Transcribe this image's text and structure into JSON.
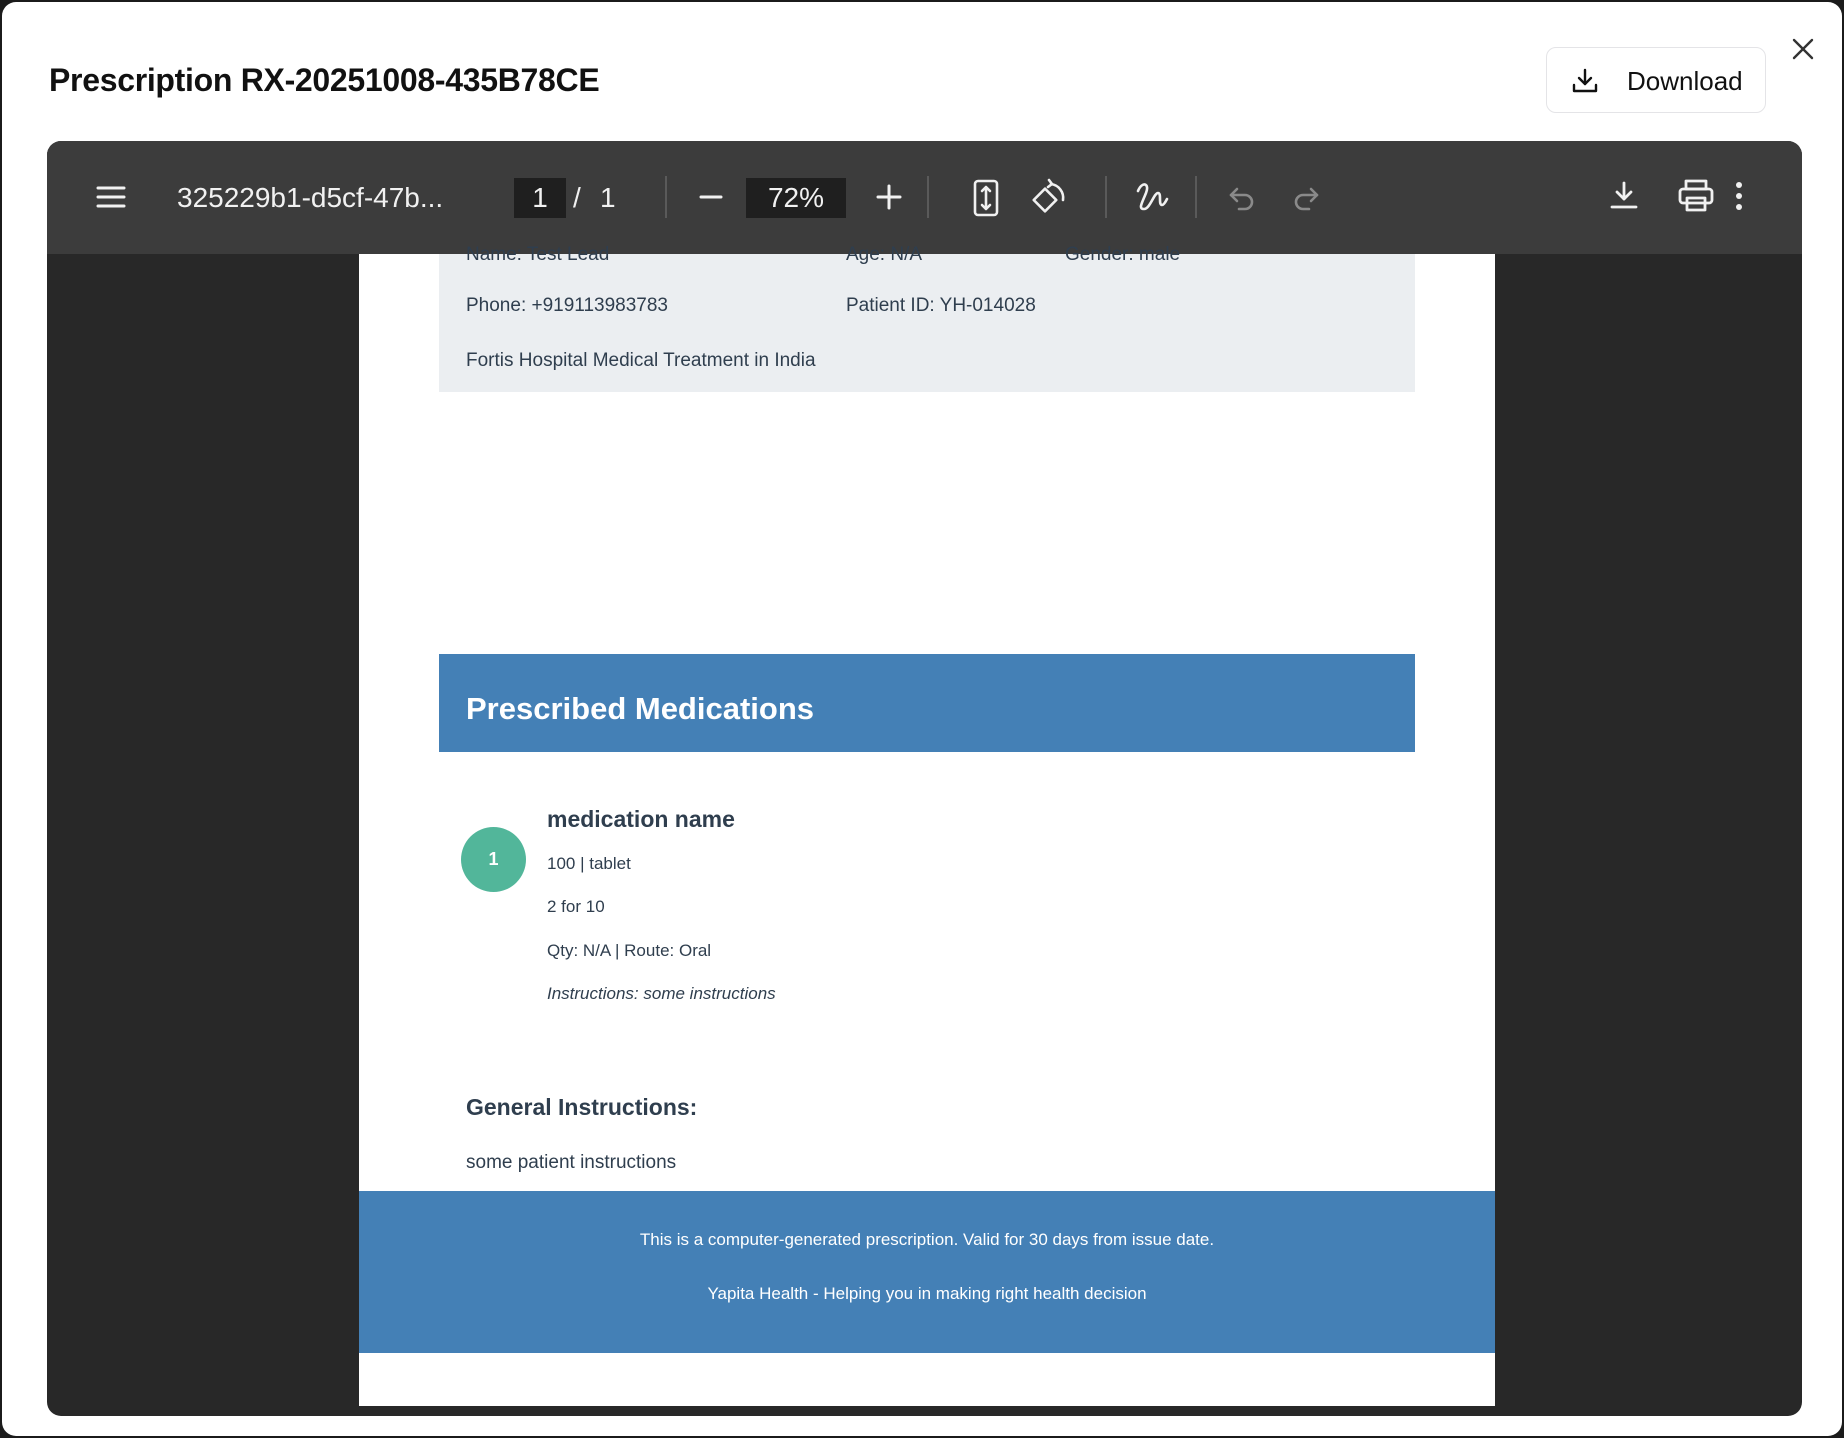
{
  "modal": {
    "title": "Prescription RX-20251008-435B78CE",
    "download_label": "Download"
  },
  "viewer": {
    "filename": "325229b1-d5cf-47b...",
    "current_page": "1",
    "page_separator": "/",
    "total_pages": "1",
    "zoom": "72%"
  },
  "document": {
    "patient": {
      "name": "Name: Test Lead",
      "age": "Age: N/A",
      "gender": "Gender: male",
      "phone": "Phone: +919113983783",
      "patient_id": "Patient ID: YH-014028",
      "hospital": "Fortis Hospital Medical Treatment in India"
    },
    "medications_header": "Prescribed Medications",
    "medications": [
      {
        "number": "1",
        "name": "medication name",
        "dose": "100 | tablet",
        "frequency": "2 for 10",
        "qty_route": "Qty: N/A | Route: Oral",
        "instructions": "Instructions: some instructions"
      }
    ],
    "general_instructions_title": "General Instructions:",
    "general_instructions_text": "some patient instructions",
    "footer": {
      "line1": "This is a computer-generated prescription. Valid for 30 days from issue date.",
      "line2": "Yapita Health - Helping you in making right health decision"
    }
  },
  "colors": {
    "toolbar_bg": "#3c3c3c",
    "viewer_bg": "#282828",
    "accent_blue": "#4480b6",
    "badge_green": "#52b69a",
    "patient_box_bg": "#ebeef1"
  },
  "icons": {
    "toolbar": [
      "menu-icon",
      "zoom-out-icon",
      "zoom-in-icon",
      "fit-page-icon",
      "rotate-icon",
      "annotate-icon",
      "undo-icon",
      "redo-icon",
      "download-icon",
      "print-icon",
      "more-options-icon"
    ],
    "modal": [
      "download-icon",
      "close-icon"
    ]
  }
}
